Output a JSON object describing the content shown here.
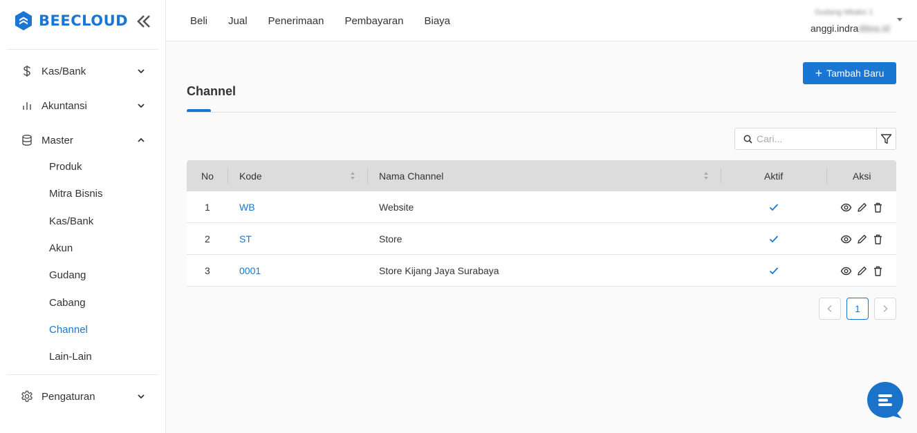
{
  "brand": {
    "name": "BEECLOUD"
  },
  "sidebar": {
    "items": [
      {
        "label": "Kas/Bank",
        "icon": "dollar-icon"
      },
      {
        "label": "Akuntansi",
        "icon": "bar-chart-icon"
      },
      {
        "label": "Master",
        "icon": "database-icon",
        "expanded": true
      }
    ],
    "sub_items": [
      {
        "label": "Produk"
      },
      {
        "label": "Mitra Bisnis"
      },
      {
        "label": "Kas/Bank"
      },
      {
        "label": "Akun"
      },
      {
        "label": "Gudang"
      },
      {
        "label": "Cabang"
      },
      {
        "label": "Channel",
        "active": true
      },
      {
        "label": "Lain-Lain"
      }
    ],
    "settings_label": "Pengaturan"
  },
  "topnav": {
    "items": [
      "Beli",
      "Jual",
      "Penerimaan",
      "Pembayaran",
      "Biaya"
    ]
  },
  "account": {
    "company": "Gudang Mbako 1",
    "email_visible": "anggi.indra",
    "email_blurred": "ditea.id"
  },
  "page": {
    "title": "Channel",
    "add_button_label": "Tambah Baru",
    "search_placeholder": "Cari..."
  },
  "table": {
    "headers": {
      "no": "No",
      "kode": "Kode",
      "nama": "Nama Channel",
      "aktif": "Aktif",
      "aksi": "Aksi"
    },
    "rows": [
      {
        "no": "1",
        "kode": "WB",
        "nama": "Website",
        "aktif": true
      },
      {
        "no": "2",
        "kode": "ST",
        "nama": "Store",
        "aktif": true
      },
      {
        "no": "3",
        "kode": "0001",
        "nama": "Store Kijang Jaya Surabaya",
        "aktif": true
      }
    ]
  },
  "pagination": {
    "current_page": "1"
  },
  "colors": {
    "primary": "#1976d2",
    "header_bg": "#dcdcdc",
    "check": "#1976d2"
  }
}
